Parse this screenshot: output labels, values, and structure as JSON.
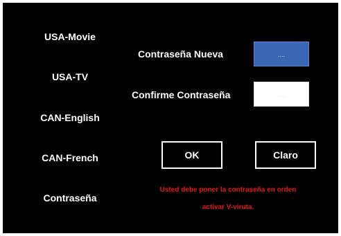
{
  "menu": {
    "items": [
      {
        "label": "USA-Movie"
      },
      {
        "label": "USA-TV"
      },
      {
        "label": "CAN-English"
      },
      {
        "label": "CAN-French"
      },
      {
        "label": "Contraseña"
      }
    ]
  },
  "form": {
    "new_password_label": "Contraseña Nueva",
    "new_password_value": "....",
    "confirm_password_label": "Confirme Contraseña",
    "confirm_password_value": "...."
  },
  "buttons": {
    "ok_label": "OK",
    "clear_label": "Claro"
  },
  "message": {
    "line1": "Usted debe poner la contraseña en orden",
    "line2": "activar V-viruta."
  },
  "colors": {
    "background": "#000000",
    "active_field": "#3a66b3",
    "warning_text": "#e0181c"
  }
}
